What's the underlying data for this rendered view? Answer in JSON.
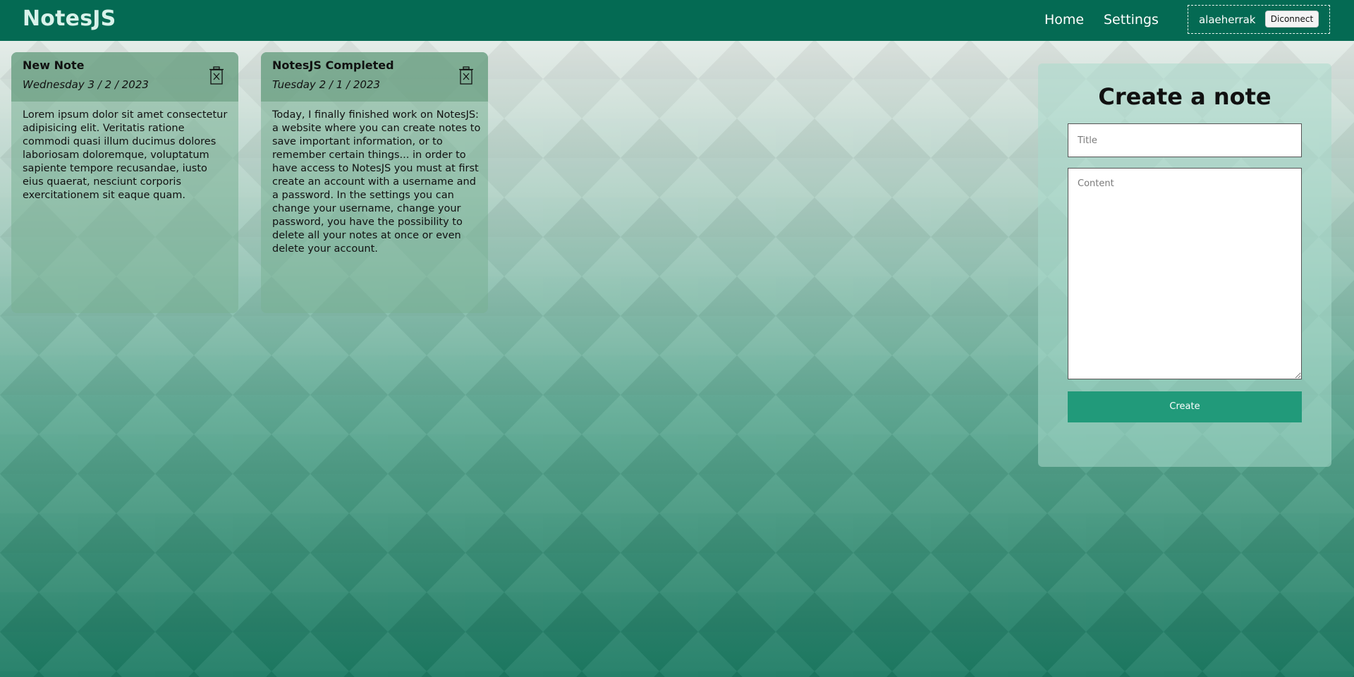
{
  "app": {
    "brand": "NotesJS"
  },
  "nav": {
    "home": "Home",
    "settings": "Settings"
  },
  "user": {
    "username": "alaeherrak",
    "disconnect_label": "Diconnect"
  },
  "notes": [
    {
      "title": "New Note",
      "date": "Wednesday 3 / 2 / 2023",
      "content": "Lorem ipsum dolor sit amet consectetur adipisicing elit. Veritatis ratione commodi quasi illum ducimus dolores laboriosam doloremque, voluptatum sapiente tempore recusandae, iusto eius quaerat, nesciunt corporis exercitationem sit eaque quam.",
      "delete_icon": "trash-icon"
    },
    {
      "title": "NotesJS Completed",
      "date": "Tuesday 2 / 1 / 2023",
      "content": "Today, I finally finished work on NotesJS: a website where you can create notes to save important information, or to remember certain things... in order to have access to NotesJS you must at first create an account with a username and a password. In the settings you can change your username, change your password, you have the possibility to delete all your notes at once or even delete your account.",
      "delete_icon": "trash-icon"
    }
  ],
  "create_form": {
    "heading": "Create a note",
    "title_placeholder": "Title",
    "title_value": "",
    "content_placeholder": "Content",
    "content_value": "",
    "submit_label": "Create"
  },
  "colors": {
    "navbar": "#046a53",
    "brand_text": "#d8f2ea",
    "create_button": "#219a7a"
  }
}
